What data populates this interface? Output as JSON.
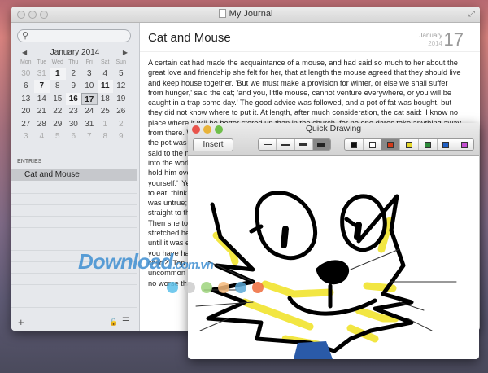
{
  "window": {
    "title": "My Journal"
  },
  "sidebar": {
    "search_placeholder": "",
    "calendar": {
      "month": "January 2014",
      "weekdays": [
        "Mon",
        "Tue",
        "Wed",
        "Thu",
        "Fri",
        "Sat",
        "Sun"
      ],
      "days": [
        [
          "30",
          "o"
        ],
        [
          "31",
          "o"
        ],
        [
          "1",
          "b"
        ],
        [
          "2",
          ""
        ],
        [
          "3",
          ""
        ],
        [
          "4",
          ""
        ],
        [
          "5",
          ""
        ],
        [
          "6",
          ""
        ],
        [
          "7",
          "b"
        ],
        [
          "8",
          ""
        ],
        [
          "9",
          ""
        ],
        [
          "10",
          ""
        ],
        [
          "11",
          "b"
        ],
        [
          "12",
          ""
        ],
        [
          "13",
          ""
        ],
        [
          "14",
          ""
        ],
        [
          "15",
          ""
        ],
        [
          "16",
          "b"
        ],
        [
          "17",
          "s"
        ],
        [
          "18",
          ""
        ],
        [
          "19",
          ""
        ],
        [
          "20",
          ""
        ],
        [
          "21",
          ""
        ],
        [
          "22",
          ""
        ],
        [
          "23",
          ""
        ],
        [
          "24",
          ""
        ],
        [
          "25",
          ""
        ],
        [
          "26",
          ""
        ],
        [
          "27",
          ""
        ],
        [
          "28",
          ""
        ],
        [
          "29",
          ""
        ],
        [
          "30",
          ""
        ],
        [
          "31",
          ""
        ],
        [
          "1",
          "o"
        ],
        [
          "2",
          "o"
        ],
        [
          "3",
          "o"
        ],
        [
          "4",
          "o"
        ],
        [
          "5",
          "o"
        ],
        [
          "6",
          "o"
        ],
        [
          "7",
          "o"
        ],
        [
          "8",
          "o"
        ],
        [
          "9",
          "o"
        ]
      ],
      "selected": "17"
    },
    "entries_header": "ENTRIES",
    "entries": [
      "Cat and Mouse"
    ],
    "footer": {
      "add": "+",
      "lock": "🔒",
      "menu": "☰"
    }
  },
  "entry": {
    "title": "Cat and Mouse",
    "month": "January",
    "year": "2014",
    "day": "17",
    "lines": [
      "A certain cat had made the acquaintance of a mouse, and had said so much to her about the",
      "great love and friendship she felt for her, that at length the mouse agreed that they should live",
      "and keep house together. 'But we must make a provision for winter, or else we shall suffer",
      "from hunger,' said the cat; 'and you, little mouse, cannot venture everywhere, or you will be",
      "caught in a trap some day.' The good advice was followed, and a pot of fat was bought, but",
      "they did not know where to put it. At length, after much consideration, the cat said: 'I know no",
      "place where it will be better stored up than in the church, for no one dares take anything away",
      "from there. We will set it beneath the altar, and not touch it until we are really in need of it.' So",
      "the pot was placed in safety, but it was not long before the cat had a great yearning for it, and",
      "said to the m",
      "into the work",
      "hold him ove",
      "yourself.' 'Ye",
      "to eat, think",
      "was untrue; t",
      "straight to th",
      "Then she too",
      "stretched he",
      "until it was e",
      "you have ha",
      "child?' 'Top c",
      "uncommon n",
      "no worse tha"
    ]
  },
  "quick_drawing": {
    "title": "Quick Drawing",
    "insert_label": "Insert",
    "stroke_widths": [
      "thin",
      "medium",
      "thick",
      "extra-thick"
    ],
    "selected_width": "extra-thick",
    "colors": [
      "#111111",
      "#ffffff",
      "#d23a1a",
      "#e6d92a",
      "#2e8b3a",
      "#1f5fc4",
      "#c34fd0"
    ],
    "selected_color": "#d23a1a"
  },
  "watermark": {
    "text": "Download",
    "suffix": ".com.vn",
    "dot_colors": [
      "#5bc0ea",
      "#cccccc",
      "#9ed37c",
      "#f4b97a",
      "#5aa8d6",
      "#ee6b3b"
    ]
  }
}
